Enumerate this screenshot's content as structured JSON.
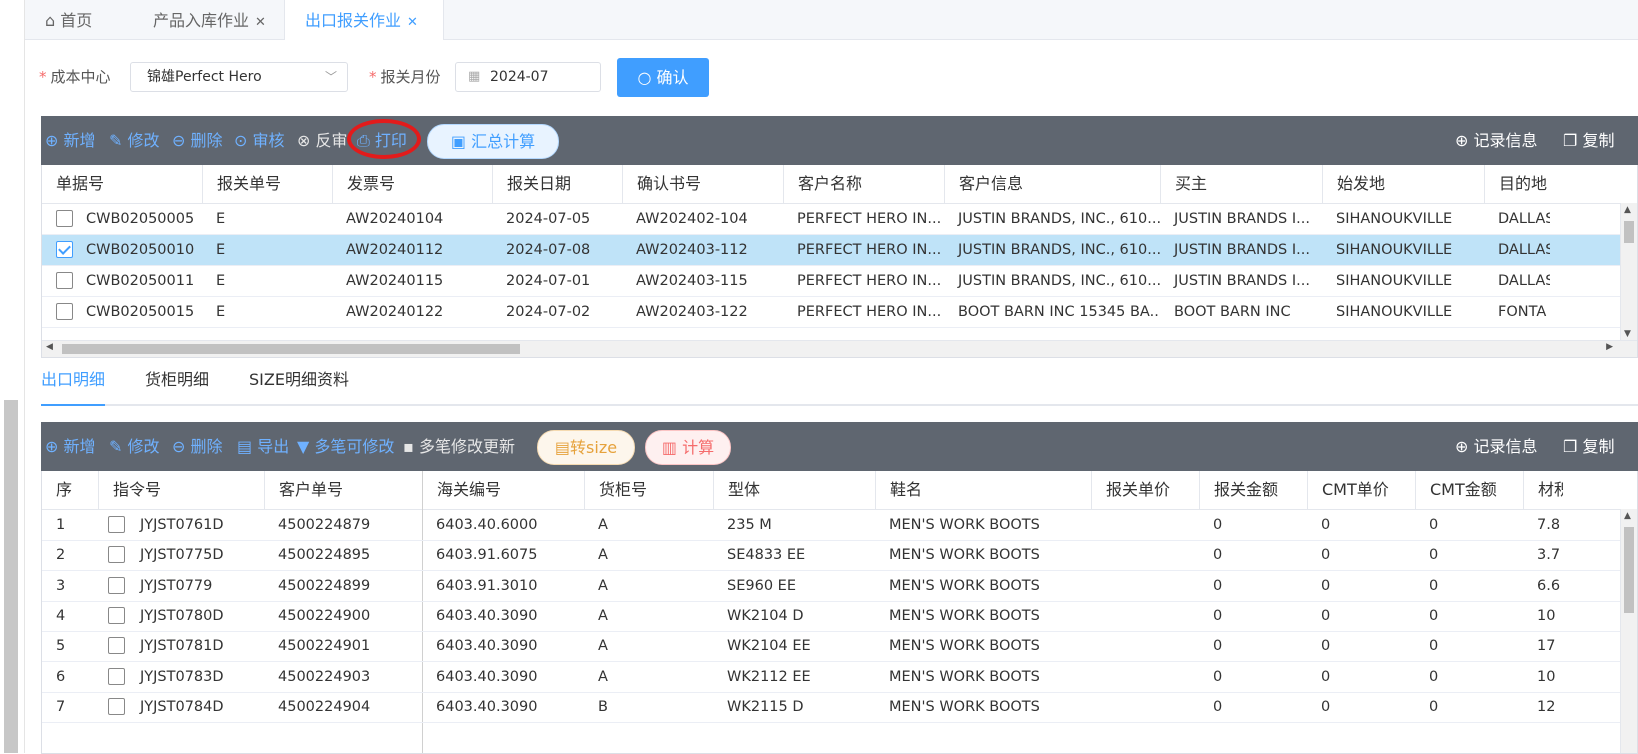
{
  "tabs": [
    {
      "label": "首页",
      "icon": "home-icon"
    },
    {
      "label": "产品入库作业",
      "closable": true
    },
    {
      "label": "出口报关作业",
      "closable": true,
      "active": true
    }
  ],
  "filter": {
    "cost_center_label": "成本中心",
    "cost_center_value": "锦雄Perfect Hero",
    "month_label": "报关月份",
    "month_value": "2024-07",
    "confirm_label": "确认"
  },
  "toolbar1": {
    "add": "新增",
    "edit": "修改",
    "delete": "删除",
    "audit": "审核",
    "unaudit": "反审",
    "print": "打印",
    "summary": "汇总计算",
    "record_info": "记录信息",
    "copy": "复制"
  },
  "grid1": {
    "columns": [
      "单据号",
      "报关单号",
      "发票号",
      "报关日期",
      "确认书号",
      "客户名称",
      "客户信息",
      "买主",
      "始发地",
      "目的地"
    ],
    "rows": [
      {
        "checked": false,
        "cells": [
          "CWB02050005",
          "E",
          "AW20240104",
          "2024-07-05",
          "AW202402-104",
          "PERFECT HERO IN...",
          "JUSTIN BRANDS, INC., 610...",
          "JUSTIN BRANDS I...",
          "SIHANOUKVILLE",
          "DALLAS"
        ]
      },
      {
        "checked": true,
        "cells": [
          "CWB02050010",
          "E",
          "AW20240112",
          "2024-07-08",
          "AW202403-112",
          "PERFECT HERO IN...",
          "JUSTIN BRANDS, INC., 610...",
          "JUSTIN BRANDS I...",
          "SIHANOUKVILLE",
          "DALLAS"
        ]
      },
      {
        "checked": false,
        "cells": [
          "CWB02050011",
          "E",
          "AW20240115",
          "2024-07-01",
          "AW202403-115",
          "PERFECT HERO IN...",
          "JUSTIN BRANDS, INC., 610...",
          "JUSTIN BRANDS I...",
          "SIHANOUKVILLE",
          "DALLAS"
        ]
      },
      {
        "checked": false,
        "cells": [
          "CWB02050015",
          "E",
          "AW20240122",
          "2024-07-02",
          "AW202403-122",
          "PERFECT HERO IN...",
          "BOOT BARN INC 15345 BA...",
          "BOOT BARN INC",
          "SIHANOUKVILLE",
          "FONTA"
        ]
      }
    ]
  },
  "subtabs": [
    "出口明细",
    "货柜明细",
    "SIZE明细资料"
  ],
  "toolbar2": {
    "add": "新增",
    "edit": "修改",
    "delete": "删除",
    "export": "导出",
    "multi_edit": "多笔可修改",
    "multi_update": "多笔修改更新",
    "to_size": "转size",
    "calc": "计算",
    "record_info": "记录信息",
    "copy": "复制"
  },
  "grid2": {
    "columns": [
      "序",
      "指令号",
      "客户单号",
      "海关编号",
      "货柜号",
      "型体",
      "鞋名",
      "报关单价",
      "报关金额",
      "CMT单价",
      "CMT金额",
      "材积"
    ],
    "rows": [
      [
        "1",
        "JYJST0761D",
        "4500224879",
        "6403.40.6000",
        "A",
        "235 M",
        "MEN'S WORK BOOTS",
        "",
        "0",
        "0",
        "0",
        "7.8"
      ],
      [
        "2",
        "JYJST0775D",
        "4500224895",
        "6403.91.6075",
        "A",
        "SE4833 EE",
        "MEN'S WORK BOOTS",
        "",
        "0",
        "0",
        "0",
        "3.7"
      ],
      [
        "3",
        "JYJST0779",
        "4500224899",
        "6403.91.3010",
        "A",
        "SE960 EE",
        "MEN'S WORK BOOTS",
        "",
        "0",
        "0",
        "0",
        "6.6"
      ],
      [
        "4",
        "JYJST0780D",
        "4500224900",
        "6403.40.3090",
        "A",
        "WK2104 D",
        "MEN'S WORK BOOTS",
        "",
        "0",
        "0",
        "0",
        "10"
      ],
      [
        "5",
        "JYJST0781D",
        "4500224901",
        "6403.40.3090",
        "A",
        "WK2104 EE",
        "MEN'S WORK BOOTS",
        "",
        "0",
        "0",
        "0",
        "17"
      ],
      [
        "6",
        "JYJST0783D",
        "4500224903",
        "6403.40.3090",
        "A",
        "WK2112 EE",
        "MEN'S WORK BOOTS",
        "",
        "0",
        "0",
        "0",
        "10"
      ],
      [
        "7",
        "JYJST0784D",
        "4500224904",
        "6403.40.3090",
        "B",
        "WK2115 D",
        "MEN'S WORK BOOTS",
        "",
        "0",
        "0",
        "0",
        "12"
      ]
    ]
  },
  "colors": {
    "accent": "#409eff",
    "toolbar": "#5f6670",
    "selected_row": "#bfe3f8",
    "annotation": "#e21b1b"
  }
}
